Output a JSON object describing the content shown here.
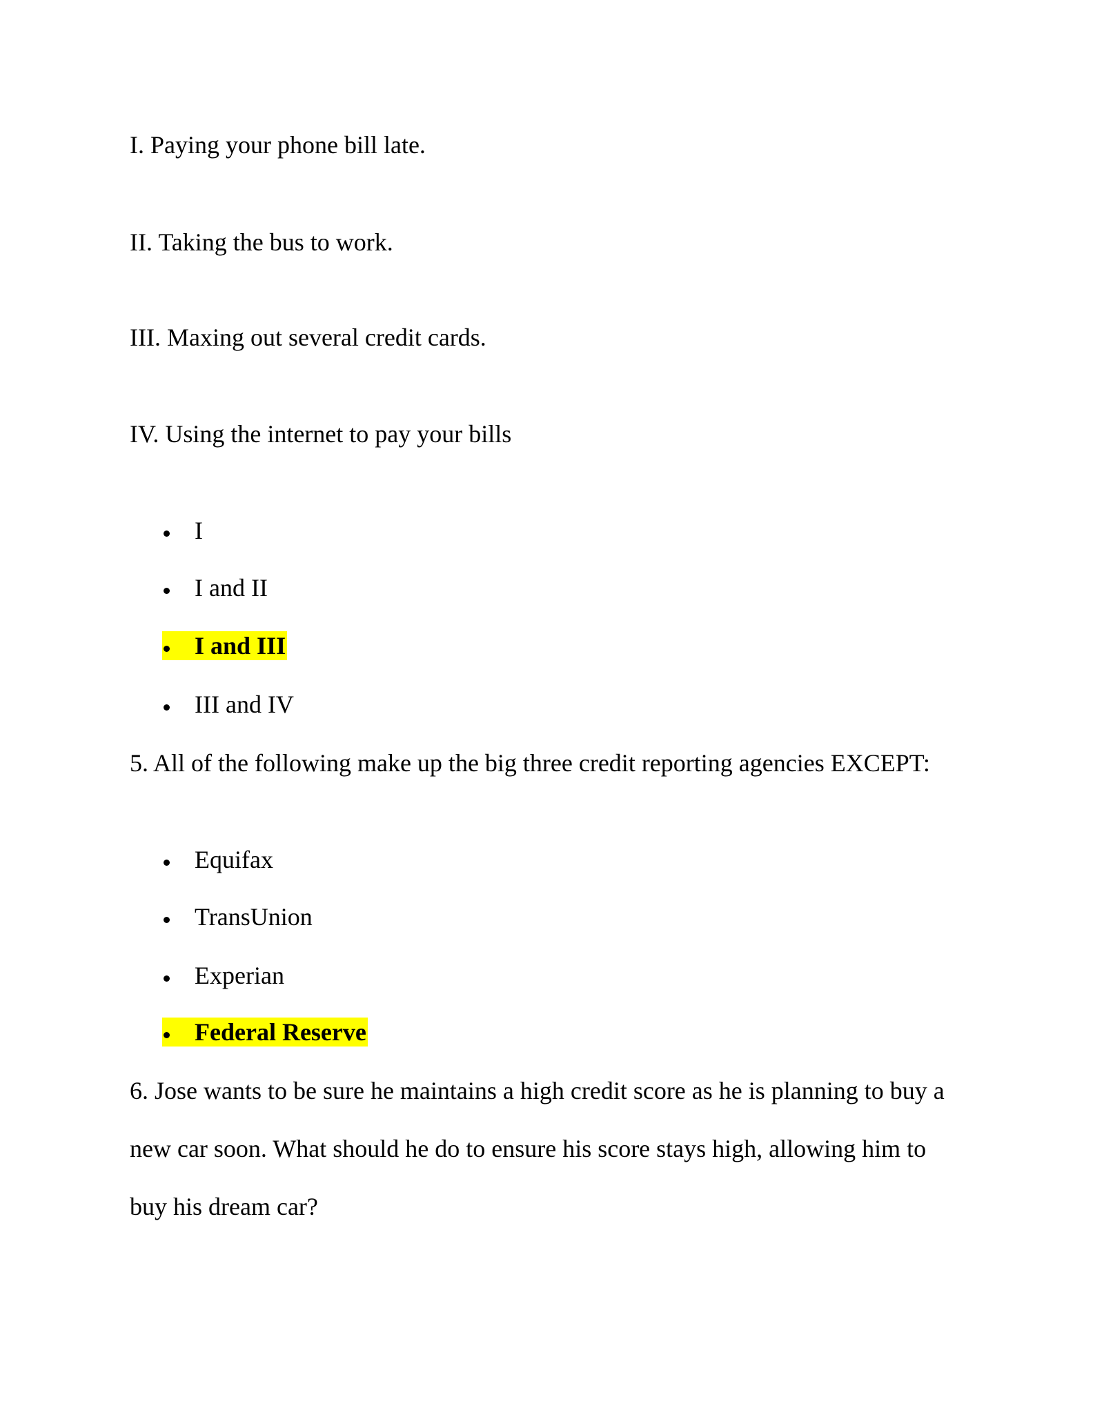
{
  "document": {
    "statements": [
      "I. Paying your phone bill late.",
      "II. Taking the bus to work.",
      "III. Maxing out several credit cards.",
      "IV. Using the internet to pay your bills"
    ],
    "q4_options": [
      {
        "label": "I",
        "highlighted": false
      },
      {
        "label": "I and II",
        "highlighted": false
      },
      {
        "label": "I and III",
        "highlighted": true
      },
      {
        "label": "III and IV",
        "highlighted": false
      }
    ],
    "q5": {
      "text": "5. All of the following make up the big three credit reporting agencies EXCEPT:",
      "options": [
        {
          "label": "Equifax",
          "highlighted": false
        },
        {
          "label": "TransUnion",
          "highlighted": false
        },
        {
          "label": "Experian",
          "highlighted": false
        },
        {
          "label": "Federal Reserve",
          "highlighted": true
        }
      ]
    },
    "q6": {
      "lines": [
        "6. Jose wants to be sure he maintains a high credit score as he is planning to buy a",
        "new car soon. What should he do to ensure his score stays high, allowing him to",
        "buy his dream car?"
      ]
    },
    "highlight_color": "#FFFF00"
  }
}
